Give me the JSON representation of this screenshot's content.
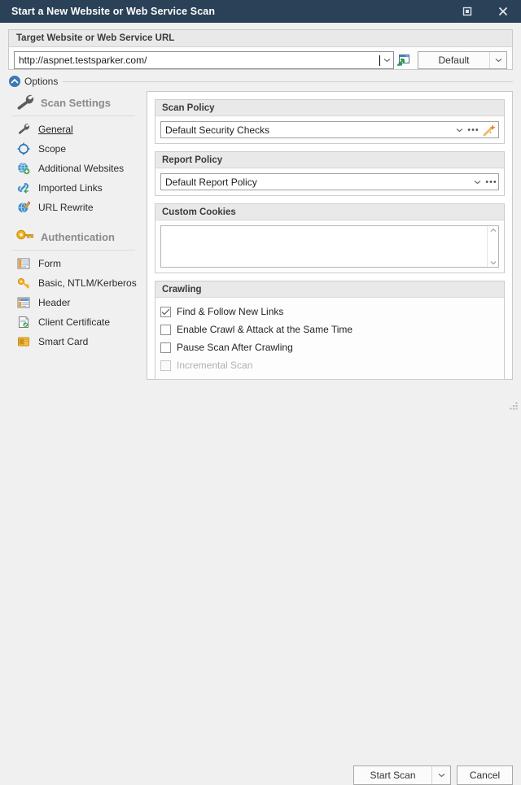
{
  "window": {
    "title": "Start a New Website or Web Service Scan",
    "controls": [
      {
        "name": "maximize",
        "icon": "maximize-icon"
      },
      {
        "name": "close",
        "icon": "close-icon"
      }
    ],
    "titlebar_color": "#2a4157"
  },
  "url_group": {
    "header": "Target Website or Web Service URL",
    "input": {
      "value": "http://aspnet.testsparker.com/",
      "placeholder": "http://",
      "dropdown_icon": "chevron-down-icon",
      "browse_icon": "open-browser-icon"
    },
    "profile_button": {
      "label": "Default",
      "dropdown_icon": "chevron-down-icon"
    }
  },
  "options": {
    "label": "Options",
    "expander_icon": "chevron-up-circle-icon",
    "expanded": true
  },
  "sidebar": {
    "sections": [
      {
        "title": "Scan Settings",
        "icon": "wrench-icon",
        "items": [
          {
            "label": "General",
            "icon": "wrench-small-icon",
            "selected": true
          },
          {
            "label": "Scope",
            "icon": "scope-icon",
            "selected": false
          },
          {
            "label": "Additional Websites",
            "icon": "globe-add-icon",
            "selected": false
          },
          {
            "label": "Imported Links",
            "icon": "link-import-icon",
            "selected": false
          },
          {
            "label": "URL Rewrite",
            "icon": "globe-edit-icon",
            "selected": false
          }
        ]
      },
      {
        "title": "Authentication",
        "icon": "key-icon",
        "items": [
          {
            "label": "Form",
            "icon": "form-icon",
            "selected": false
          },
          {
            "label": "Basic, NTLM/Kerberos",
            "icon": "key-small-icon",
            "selected": false
          },
          {
            "label": "Header",
            "icon": "header-icon",
            "selected": false
          },
          {
            "label": "Client Certificate",
            "icon": "certificate-icon",
            "selected": false
          },
          {
            "label": "Smart Card",
            "icon": "smartcard-icon",
            "selected": false
          }
        ]
      }
    ]
  },
  "main": {
    "scan_policy": {
      "header": "Scan Policy",
      "value": "Default Security Checks",
      "dropdown_icon": "chevron-down-icon",
      "more_icon": "ellipsis-icon",
      "wand_icon": "magic-wand-icon"
    },
    "report_policy": {
      "header": "Report Policy",
      "value": "Default Report Policy",
      "dropdown_icon": "chevron-down-icon",
      "more_icon": "ellipsis-icon"
    },
    "custom_cookies": {
      "header": "Custom Cookies",
      "value": "",
      "scroll_up_icon": "chevron-up-icon",
      "scroll_down_icon": "chevron-down-icon"
    },
    "crawling": {
      "header": "Crawling",
      "checkboxes": [
        {
          "label": "Find & Follow New Links",
          "checked": true,
          "disabled": false
        },
        {
          "label": "Enable Crawl & Attack at the Same Time",
          "checked": false,
          "disabled": false
        },
        {
          "label": "Pause Scan After Crawling",
          "checked": false,
          "disabled": false
        },
        {
          "label": "Incremental Scan",
          "checked": false,
          "disabled": true
        }
      ]
    }
  },
  "footer": {
    "start_scan": {
      "label": "Start Scan",
      "dropdown_icon": "chevron-down-icon"
    },
    "cancel": {
      "label": "Cancel"
    },
    "resize_grip_icon": "resize-grip-icon"
  }
}
